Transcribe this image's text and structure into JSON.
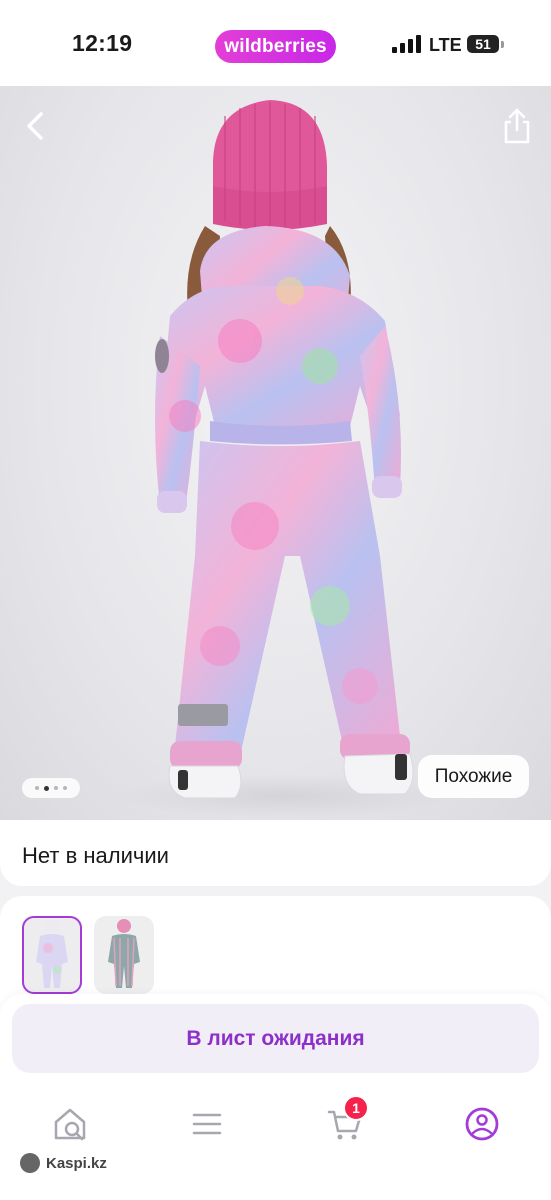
{
  "status_bar": {
    "time": "12:19",
    "app_badge": "wildberries",
    "network": "LTE",
    "battery": "51"
  },
  "hero": {
    "back_icon": "chevron-left-icon",
    "share_icon": "share-icon",
    "gallery_index": 2,
    "gallery_total": 4,
    "similar_label": "Похожие"
  },
  "product": {
    "availability": "Нет в наличии",
    "variants_selected": 1
  },
  "actions": {
    "waitlist_label": "В лист ожидания"
  },
  "nav": {
    "items": [
      "home-search-icon",
      "catalog-menu-icon",
      "cart-icon",
      "profile-icon"
    ],
    "cart_count": "1",
    "active_color": "#a43bd8"
  },
  "watermark": {
    "label": "Kaspi.kz"
  },
  "colors": {
    "brand_gradient_start": "#e23fd6",
    "brand_gradient_end": "#c927e8",
    "accent": "#8d2fc9",
    "badge": "#f5234b"
  }
}
